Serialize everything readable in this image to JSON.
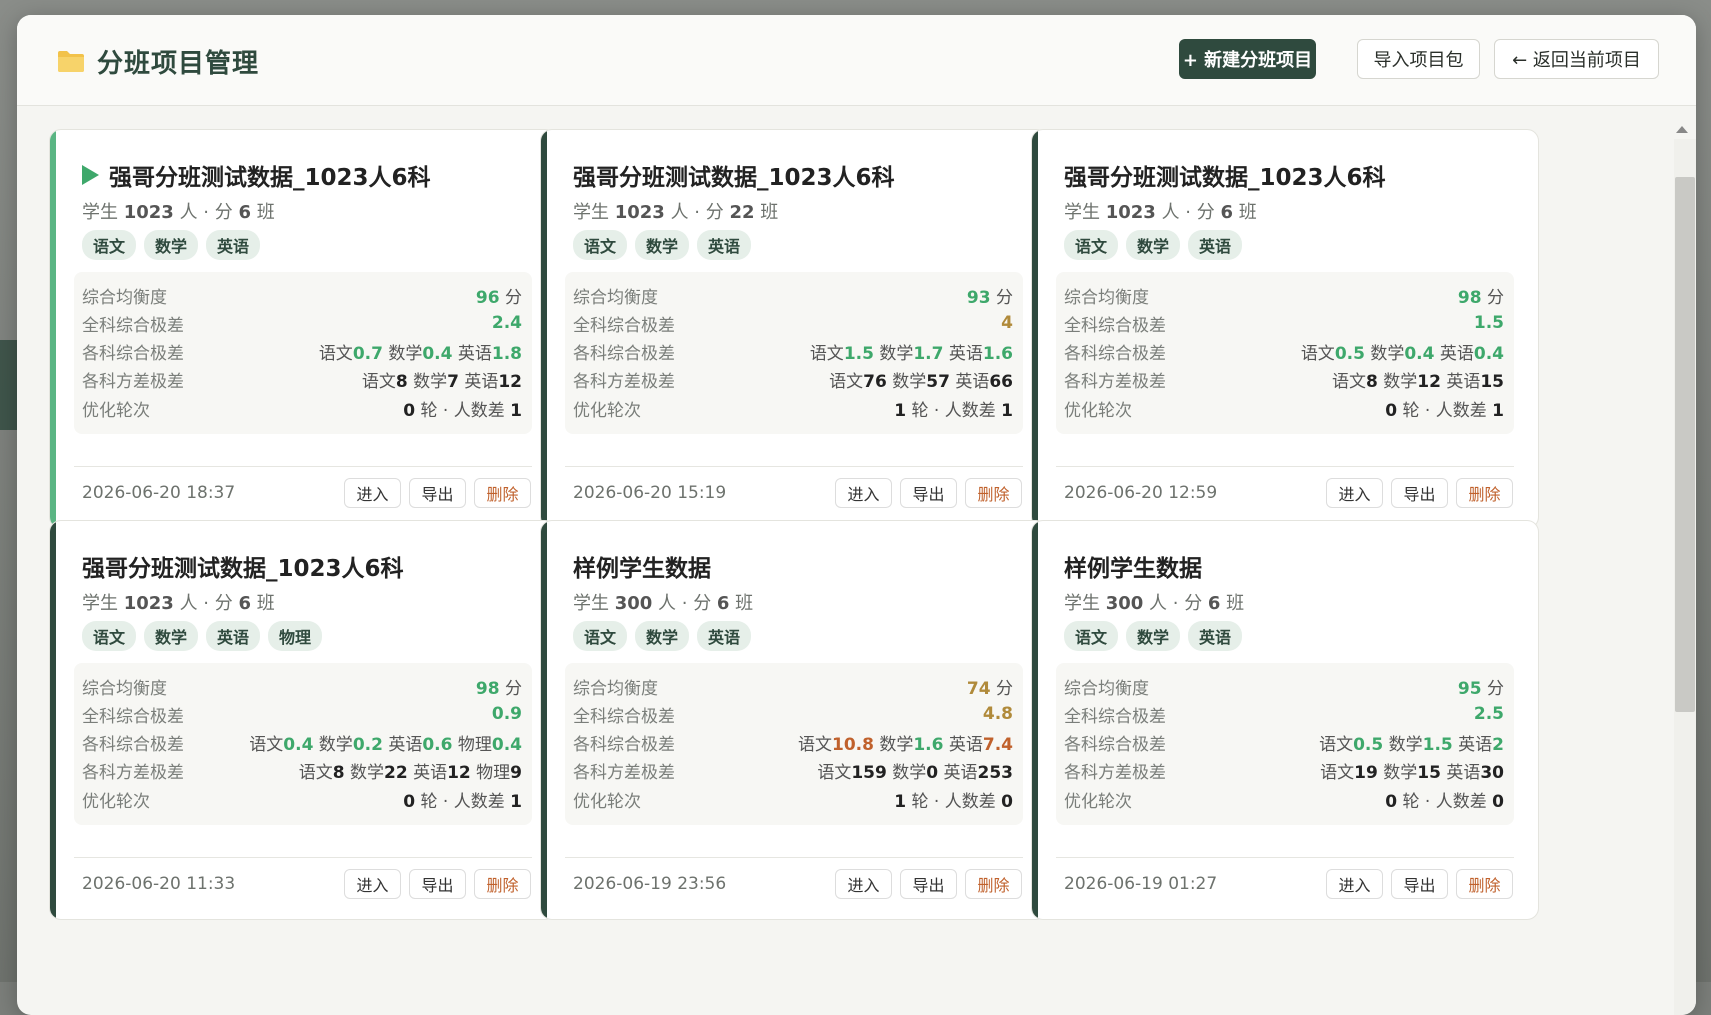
{
  "header": {
    "title": "分班项目管理",
    "new_project_label": "+ 新建分班项目",
    "import_label": "导入项目包",
    "back_label": "← 返回当前项目"
  },
  "labels": {
    "balance": "综合均衡度",
    "overall_range": "全科综合极差",
    "subject_range": "各科综合极差",
    "variance_range": "各科方差极差",
    "rounds": "优化轮次",
    "enter": "进入",
    "export": "导出",
    "delete": "删除",
    "score_unit": "分"
  },
  "colors": {
    "accent": "#2f4a3e",
    "active_bar": "#5ab583",
    "good": "#3ea86b",
    "warn": "#b08a3a",
    "bad": "#c0612c"
  },
  "projects": [
    {
      "active": true,
      "name": "强哥分班测试数据_1023人6科",
      "meta": "学生 1023 人 · 分 6 班",
      "students": "1023",
      "classes": "6",
      "tags": [
        "语文",
        "数学",
        "英语"
      ],
      "balance": "96",
      "balance_color": "green",
      "overall_range": "2.4",
      "overall_color": "green",
      "subject_range": [
        {
          "s": "语文",
          "v": "0.7",
          "c": "green"
        },
        {
          "s": "数学",
          "v": "0.4",
          "c": "green"
        },
        {
          "s": "英语",
          "v": "1.8",
          "c": "green"
        }
      ],
      "variance_range": [
        {
          "s": "语文",
          "v": "8"
        },
        {
          "s": "数学",
          "v": "7"
        },
        {
          "s": "英语",
          "v": "12"
        }
      ],
      "rounds": "0",
      "size_diff": "1",
      "date": "2026-06-20 18:37"
    },
    {
      "active": false,
      "name": "强哥分班测试数据_1023人6科",
      "students": "1023",
      "classes": "22",
      "tags": [
        "语文",
        "数学",
        "英语"
      ],
      "balance": "93",
      "balance_color": "green",
      "overall_range": "4",
      "overall_color": "amber",
      "subject_range": [
        {
          "s": "语文",
          "v": "1.5",
          "c": "green"
        },
        {
          "s": "数学",
          "v": "1.7",
          "c": "green"
        },
        {
          "s": "英语",
          "v": "1.6",
          "c": "green"
        }
      ],
      "variance_range": [
        {
          "s": "语文",
          "v": "76"
        },
        {
          "s": "数学",
          "v": "57"
        },
        {
          "s": "英语",
          "v": "66"
        }
      ],
      "rounds": "1",
      "size_diff": "1",
      "date": "2026-06-20 15:19"
    },
    {
      "active": false,
      "name": "强哥分班测试数据_1023人6科",
      "students": "1023",
      "classes": "6",
      "tags": [
        "语文",
        "数学",
        "英语"
      ],
      "balance": "98",
      "balance_color": "green",
      "overall_range": "1.5",
      "overall_color": "green",
      "subject_range": [
        {
          "s": "语文",
          "v": "0.5",
          "c": "green"
        },
        {
          "s": "数学",
          "v": "0.4",
          "c": "green"
        },
        {
          "s": "英语",
          "v": "0.4",
          "c": "green"
        }
      ],
      "variance_range": [
        {
          "s": "语文",
          "v": "8"
        },
        {
          "s": "数学",
          "v": "12"
        },
        {
          "s": "英语",
          "v": "15"
        }
      ],
      "rounds": "0",
      "size_diff": "1",
      "date": "2026-06-20 12:59"
    },
    {
      "active": false,
      "name": "强哥分班测试数据_1023人6科",
      "students": "1023",
      "classes": "6",
      "tags": [
        "语文",
        "数学",
        "英语",
        "物理"
      ],
      "balance": "98",
      "balance_color": "green",
      "overall_range": "0.9",
      "overall_color": "green",
      "subject_range": [
        {
          "s": "语文",
          "v": "0.4",
          "c": "green"
        },
        {
          "s": "数学",
          "v": "0.2",
          "c": "green"
        },
        {
          "s": "英语",
          "v": "0.6",
          "c": "green"
        },
        {
          "s": "物理",
          "v": "0.4",
          "c": "green"
        }
      ],
      "variance_range": [
        {
          "s": "语文",
          "v": "8"
        },
        {
          "s": "数学",
          "v": "22"
        },
        {
          "s": "英语",
          "v": "12"
        },
        {
          "s": "物理",
          "v": "9"
        }
      ],
      "rounds": "0",
      "size_diff": "1",
      "date": "2026-06-20 11:33"
    },
    {
      "active": false,
      "name": "样例学生数据",
      "students": "300",
      "classes": "6",
      "tags": [
        "语文",
        "数学",
        "英语"
      ],
      "balance": "74",
      "balance_color": "amber",
      "overall_range": "4.8",
      "overall_color": "amber",
      "subject_range": [
        {
          "s": "语文",
          "v": "10.8",
          "c": "orange"
        },
        {
          "s": "数学",
          "v": "1.6",
          "c": "green"
        },
        {
          "s": "英语",
          "v": "7.4",
          "c": "orange"
        }
      ],
      "variance_range": [
        {
          "s": "语文",
          "v": "159"
        },
        {
          "s": "数学",
          "v": "0"
        },
        {
          "s": "英语",
          "v": "253"
        }
      ],
      "rounds": "1",
      "size_diff": "0",
      "date": "2026-06-19 23:56"
    },
    {
      "active": false,
      "name": "样例学生数据",
      "students": "300",
      "classes": "6",
      "tags": [
        "语文",
        "数学",
        "英语"
      ],
      "balance": "95",
      "balance_color": "green",
      "overall_range": "2.5",
      "overall_color": "green",
      "subject_range": [
        {
          "s": "语文",
          "v": "0.5",
          "c": "green"
        },
        {
          "s": "数学",
          "v": "1.5",
          "c": "green"
        },
        {
          "s": "英语",
          "v": "2",
          "c": "green"
        }
      ],
      "variance_range": [
        {
          "s": "语文",
          "v": "19"
        },
        {
          "s": "数学",
          "v": "15"
        },
        {
          "s": "英语",
          "v": "30"
        }
      ],
      "rounds": "0",
      "size_diff": "0",
      "date": "2026-06-19 01:27"
    }
  ]
}
